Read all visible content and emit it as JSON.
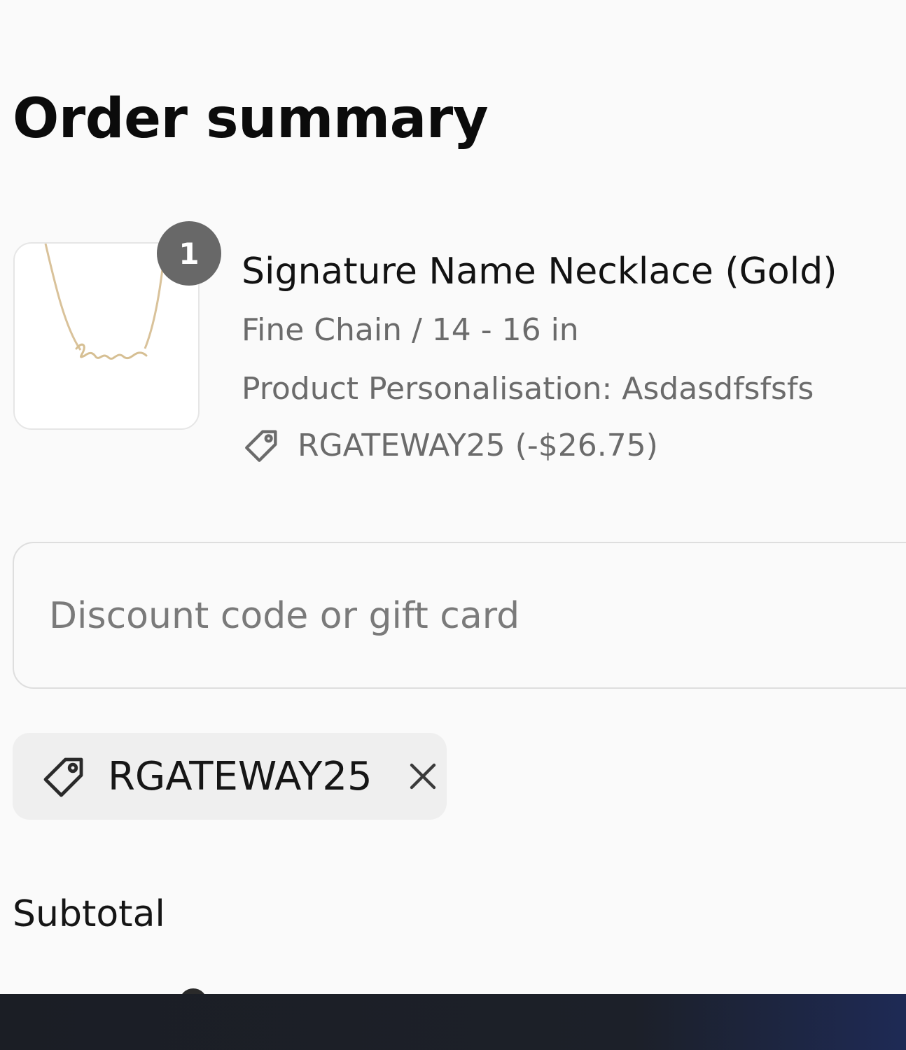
{
  "summary": {
    "title": "Order summary"
  },
  "line_item": {
    "quantity": "1",
    "name": "Signature Name Necklace (Gold)",
    "variant": "Fine Chain / 14 - 16 in",
    "personalisation": "Product Personalisation: Asdasdfsfsfs",
    "discount": "RGATEWAY25 (-$26.75)",
    "image_icon": "necklace-image"
  },
  "discount_input": {
    "placeholder": "Discount code or gift card",
    "value": ""
  },
  "applied_code": {
    "code": "RGATEWAY25",
    "icon": "tag-icon",
    "remove_icon": "close-icon"
  },
  "totals": {
    "subtotal_label": "Subtotal"
  },
  "colors": {
    "badge": "#686868",
    "muted_text": "#6b6b6b",
    "chip_bg": "#efefef",
    "taskbar": "#1b1e25"
  }
}
